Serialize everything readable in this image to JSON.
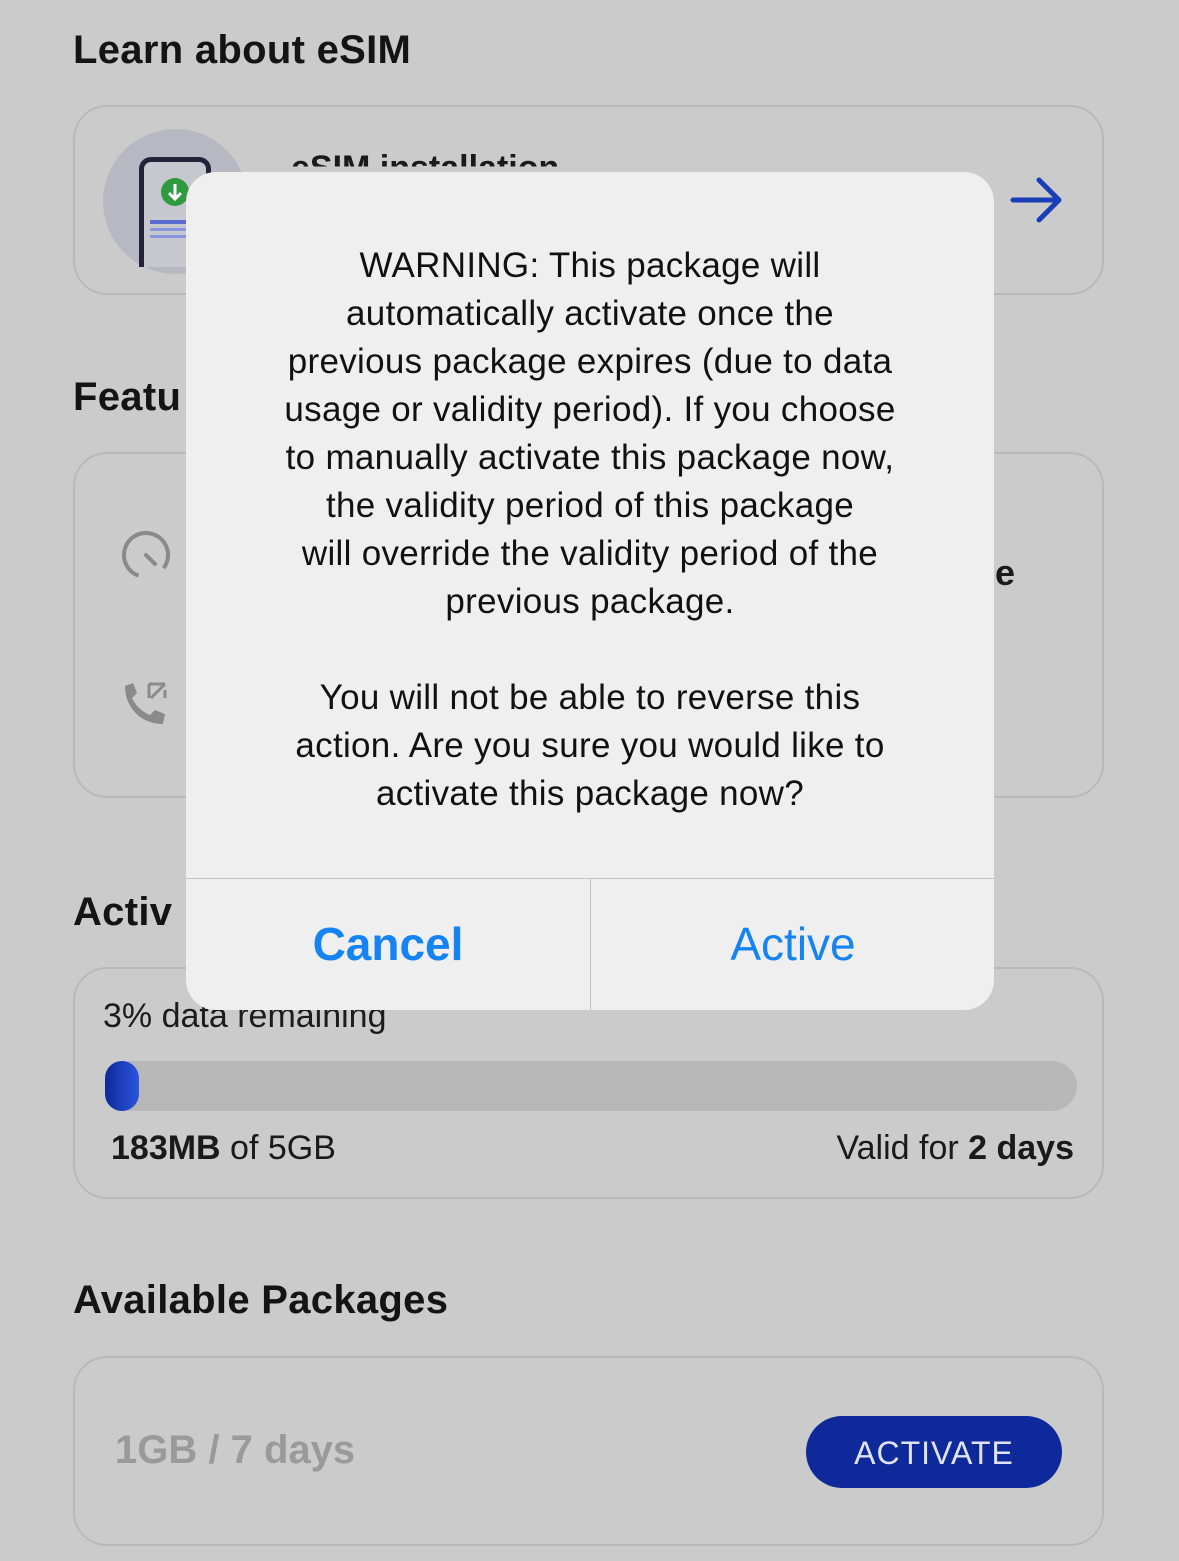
{
  "learn": {
    "section_title": "Learn about eSIM",
    "card_title": "eSIM installation"
  },
  "features": {
    "section_title": "Featu",
    "trailing_text": "e"
  },
  "active": {
    "section_title": "Activ",
    "remaining_text": "3% data remaining",
    "percent_remaining": 3,
    "used_amount": "183MB",
    "total_text": " of 5GB",
    "valid_prefix": "Valid for ",
    "valid_days": "2 days"
  },
  "packages": {
    "section_title": "Available Packages",
    "items": [
      {
        "name": "1GB / 7 days",
        "button_label": "ACTIVATE"
      }
    ]
  },
  "dialog": {
    "message": "WARNING: This package will\nautomatically activate once the\nprevious package expires (due to data\nusage or validity period). If you choose\nto manually activate this package now,\nthe validity period of this package\nwill override the validity period of the\nprevious package.\n\nYou will not be able to reverse this\naction. Are you sure you would like to\nactivate this package now?",
    "cancel_label": "Cancel",
    "confirm_label": "Active"
  },
  "colors": {
    "brand": "#0e2a9a",
    "ios_blue": "#1583f2",
    "dim_background": "#cbcbcb"
  }
}
